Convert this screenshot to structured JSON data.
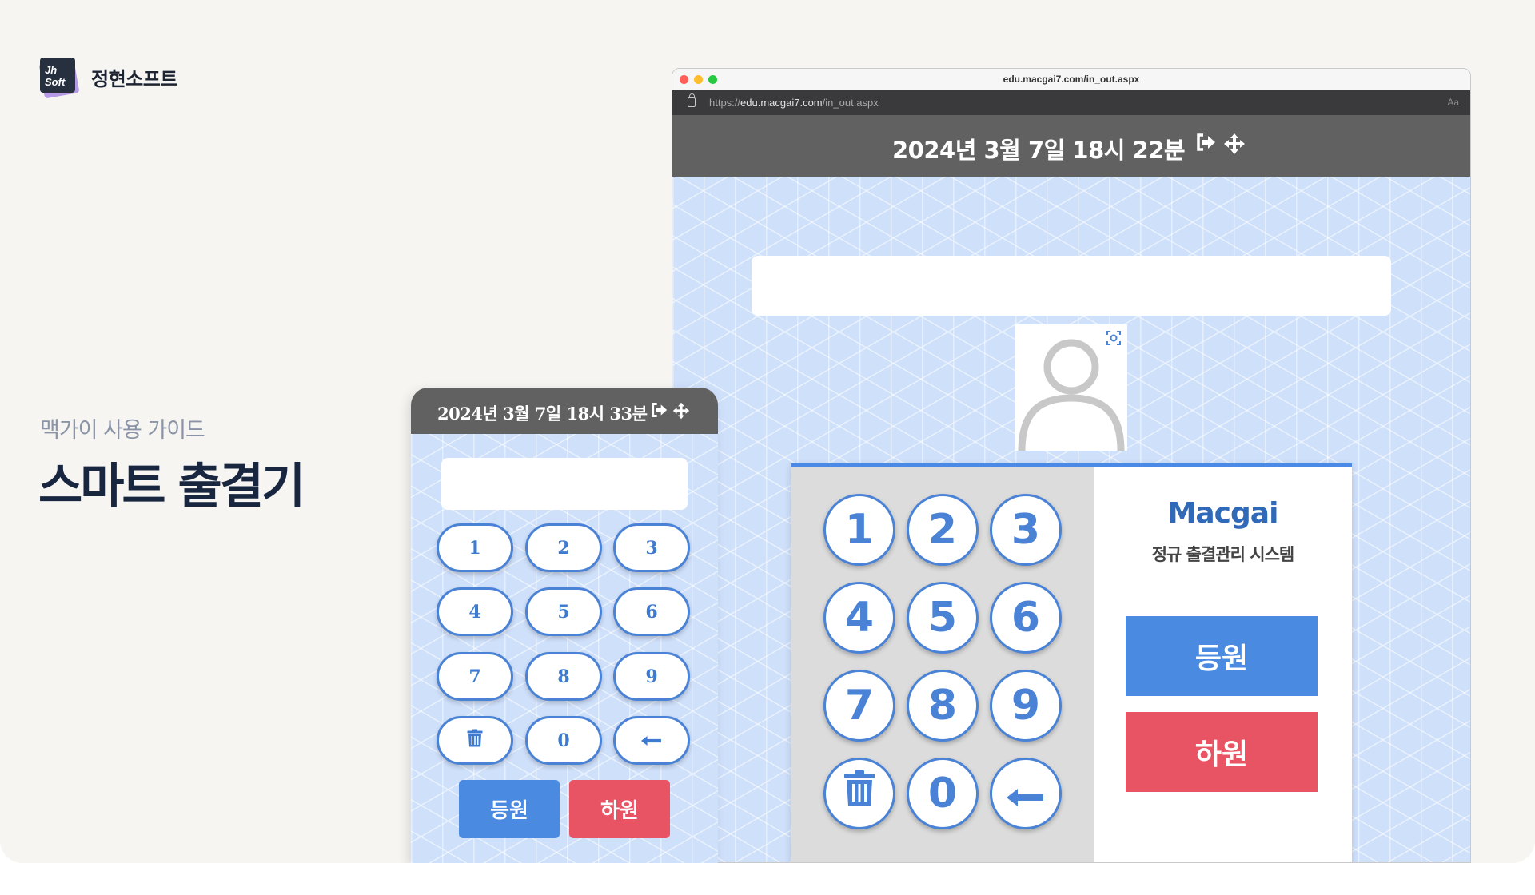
{
  "brand": {
    "logo_text": "Jh Soft",
    "name": "정현소프트"
  },
  "guide": {
    "subtitle": "맥가이 사용 가이드",
    "title": "스마트 출결기"
  },
  "browser": {
    "window_title": "edu.macgai7.com/in_out.aspx",
    "url_prefix": "https://",
    "url_host": "edu.macgai7.com",
    "url_path": "/in_out.aspx",
    "reader_icon": "Aa"
  },
  "large_app": {
    "clock": "2024년 3월 7일 18시 22분",
    "header_icons": [
      "sign-out-icon",
      "move-icon"
    ],
    "code_input_value": "",
    "keys": [
      "1",
      "2",
      "3",
      "4",
      "5",
      "6",
      "7",
      "8",
      "9",
      "trash",
      "0",
      "backspace"
    ],
    "brand_name": "Macgai",
    "system_name": "정규 출결관리 시스템",
    "checkin_label": "등원",
    "checkout_label": "하원",
    "colors": {
      "accent": "#4a8ae6",
      "checkin": "#4a8ae0",
      "checkout": "#e95465",
      "header": "#616161"
    }
  },
  "small_app": {
    "clock": "2024년 3월 7일 18시 33분",
    "header_icons": [
      "sign-out-icon",
      "move-icon"
    ],
    "code_input_value": "",
    "keys": [
      "1",
      "2",
      "3",
      "4",
      "5",
      "6",
      "7",
      "8",
      "9",
      "trash",
      "0",
      "backspace"
    ],
    "checkin_label": "등원",
    "checkout_label": "하원"
  }
}
